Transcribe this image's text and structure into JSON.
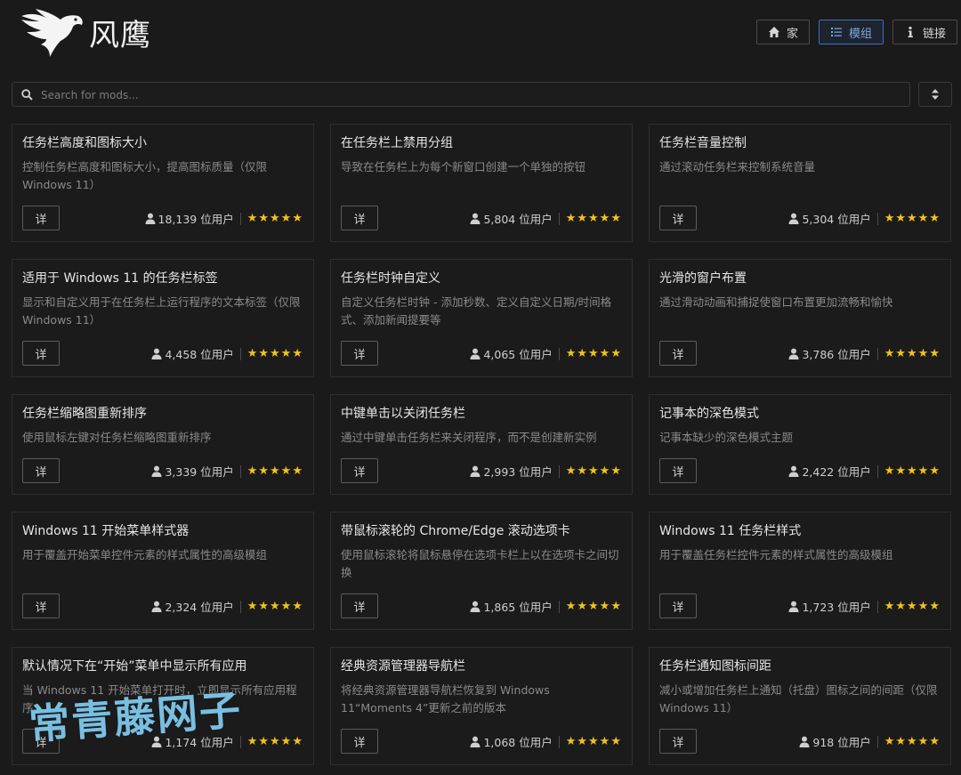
{
  "brand": {
    "name": "风鹰"
  },
  "nav": {
    "home": {
      "label": "家",
      "icon": "home-icon"
    },
    "mods": {
      "label": "模组",
      "icon": "list-icon"
    },
    "links": {
      "label": "链接",
      "icon": "info-icon"
    }
  },
  "search": {
    "placeholder": "Search for mods...",
    "value": ""
  },
  "sort": {
    "icon": "sort-icon"
  },
  "colors": {
    "accent": "#3f6fb5",
    "star": "#f2c21a",
    "background": "#1a1a1b"
  },
  "cards": [
    {
      "title": "任务栏高度和图标大小",
      "description": "控制任务栏高度和图标大小，提高图标质量（仅限Windows 11）",
      "detail": "详",
      "users": "18,139 位用户",
      "stars": "★★★★★"
    },
    {
      "title": "在任务栏上禁用分组",
      "description": "导致在任务栏上为每个新窗口创建一个单独的按钮",
      "detail": "详",
      "users": "5,804 位用户",
      "stars": "★★★★★"
    },
    {
      "title": "任务栏音量控制",
      "description": "通过滚动任务栏来控制系统音量",
      "detail": "详",
      "users": "5,304 位用户",
      "stars": "★★★★★"
    },
    {
      "title": "适用于 Windows 11 的任务栏标签",
      "description": "显示和自定义用于在任务栏上运行程序的文本标签（仅限 Windows 11）",
      "detail": "详",
      "users": "4,458 位用户",
      "stars": "★★★★★"
    },
    {
      "title": "任务栏时钟自定义",
      "description": "自定义任务栏时钟 - 添加秒数、定义自定义日期/时间格式、添加新闻提要等",
      "detail": "详",
      "users": "4,065 位用户",
      "stars": "★★★★★"
    },
    {
      "title": "光滑的窗户布置",
      "description": "通过滑动动画和捕捉使窗口布置更加流畅和愉快",
      "detail": "详",
      "users": "3,786 位用户",
      "stars": "★★★★★"
    },
    {
      "title": "任务栏缩略图重新排序",
      "description": "使用鼠标左键对任务栏缩略图重新排序",
      "detail": "详",
      "users": "3,339 位用户",
      "stars": "★★★★★"
    },
    {
      "title": "中键单击以关闭任务栏",
      "description": "通过中键单击任务栏来关闭程序，而不是创建新实例",
      "detail": "详",
      "users": "2,993 位用户",
      "stars": "★★★★★"
    },
    {
      "title": "记事本的深色模式",
      "description": "记事本缺少的深色模式主题",
      "detail": "详",
      "users": "2,422 位用户",
      "stars": "★★★★★"
    },
    {
      "title": "Windows 11 开始菜单样式器",
      "description": "用于覆盖开始菜单控件元素的样式属性的高级模组",
      "detail": "详",
      "users": "2,324 位用户",
      "stars": "★★★★★"
    },
    {
      "title": "带鼠标滚轮的 Chrome/Edge 滚动选项卡",
      "description": "使用鼠标滚轮将鼠标悬停在选项卡栏上以在选项卡之间切换",
      "detail": "详",
      "users": "1,865 位用户",
      "stars": "★★★★★"
    },
    {
      "title": "Windows 11 任务栏样式",
      "description": "用于覆盖任务栏控件元素的样式属性的高级模组",
      "detail": "详",
      "users": "1,723 位用户",
      "stars": "★★★★★"
    },
    {
      "title": "默认情况下在“开始”菜单中显示所有应用",
      "description": "当 Windows 11 开始菜单打开时，立即显示所有应用程序",
      "detail": "详",
      "users": "1,174 位用户",
      "stars": "★★★★★"
    },
    {
      "title": "经典资源管理器导航栏",
      "description": "将经典资源管理器导航栏恢复到 Windows 11“Moments 4”更新之前的版本",
      "detail": "详",
      "users": "1,068 位用户",
      "stars": "★★★★★"
    },
    {
      "title": "任务栏通知图标间距",
      "description": "减小或增加任务栏上通知（托盘）图标之间的间距（仅限 Windows 11）",
      "detail": "详",
      "users": "918 位用户",
      "stars": "★★★★★"
    }
  ],
  "watermark": "常青藤网子"
}
